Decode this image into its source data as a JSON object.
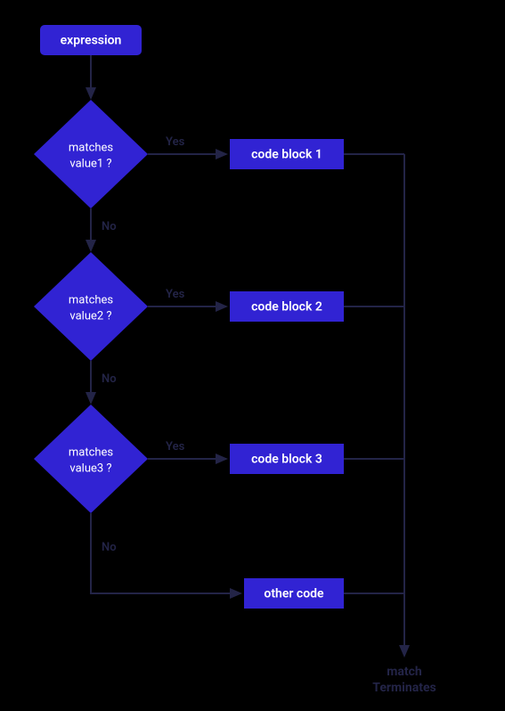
{
  "start": {
    "label": "expression"
  },
  "decisions": [
    {
      "line1": "matches",
      "line2": "value1 ?",
      "yes": "Yes",
      "no": "No"
    },
    {
      "line1": "matches",
      "line2": "value2 ?",
      "yes": "Yes",
      "no": "No"
    },
    {
      "line1": "matches",
      "line2": "value3 ?",
      "yes": "Yes",
      "no": "No"
    }
  ],
  "blocks": [
    {
      "label": "code block 1"
    },
    {
      "label": "code block 2"
    },
    {
      "label": "code block 3"
    },
    {
      "label": "other code"
    }
  ],
  "terminate": {
    "line1": "match",
    "line2": "Terminates"
  }
}
